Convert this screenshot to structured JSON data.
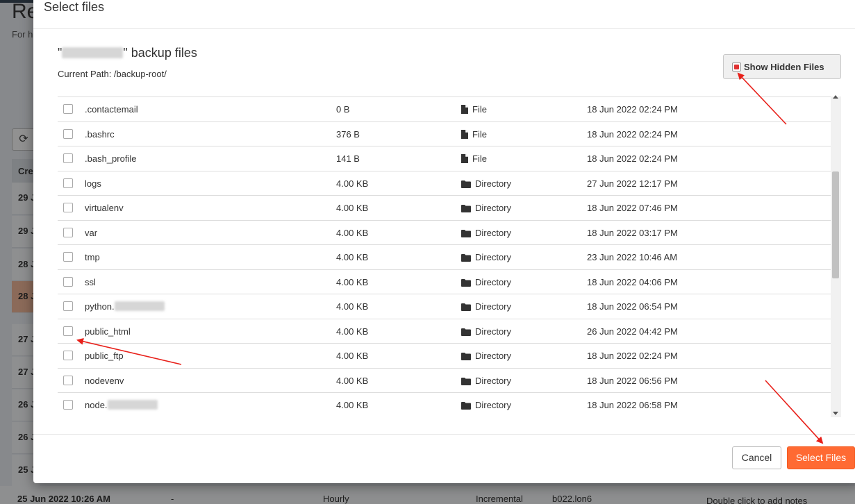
{
  "background": {
    "title": "Re",
    "subtitle": "For h",
    "table_header": "Cre",
    "rows": [
      "29 J",
      "29 J",
      "28 J",
      "28 J",
      "27 J",
      "27 J",
      "26 J",
      "26 J",
      "25 J"
    ],
    "bottom_row": {
      "created": "25 Jun 2022 10:26 AM",
      "dash": "-",
      "frequency": "Hourly",
      "type": "Incremental",
      "server": "b022.lon6",
      "notes": "Double click to add notes"
    }
  },
  "modal": {
    "title": "Select files",
    "files_title_prefix": "\"",
    "files_title_suffix": "\" backup files",
    "current_path_label": "Current Path: /backup-root/",
    "show_hidden_label": "Show Hidden Files",
    "cancel_label": "Cancel",
    "select_label": "Select Files",
    "files": [
      {
        "name": ".contactemail",
        "size": "0 B",
        "type": "File",
        "date": "18 Jun 2022 02:24 PM",
        "icon": "file-icon"
      },
      {
        "name": ".bashrc",
        "size": "376 B",
        "type": "File",
        "date": "18 Jun 2022 02:24 PM",
        "icon": "file-icon"
      },
      {
        "name": ".bash_profile",
        "size": "141 B",
        "type": "File",
        "date": "18 Jun 2022 02:24 PM",
        "icon": "file-icon"
      },
      {
        "name": "logs",
        "size": "4.00 KB",
        "type": "Directory",
        "date": "27 Jun 2022 12:17 PM",
        "icon": "folder-icon"
      },
      {
        "name": "virtualenv",
        "size": "4.00 KB",
        "type": "Directory",
        "date": "18 Jun 2022 07:46 PM",
        "icon": "folder-icon"
      },
      {
        "name": "var",
        "size": "4.00 KB",
        "type": "Directory",
        "date": "18 Jun 2022 03:17 PM",
        "icon": "folder-icon"
      },
      {
        "name": "tmp",
        "size": "4.00 KB",
        "type": "Directory",
        "date": "23 Jun 2022 10:46 AM",
        "icon": "folder-icon"
      },
      {
        "name": "ssl",
        "size": "4.00 KB",
        "type": "Directory",
        "date": "18 Jun 2022 04:06 PM",
        "icon": "folder-icon"
      },
      {
        "name": "python.",
        "size": "4.00 KB",
        "type": "Directory",
        "date": "18 Jun 2022 06:54 PM",
        "icon": "folder-icon"
      },
      {
        "name": "public_html",
        "size": "4.00 KB",
        "type": "Directory",
        "date": "26 Jun 2022 04:42 PM",
        "icon": "folder-icon"
      },
      {
        "name": "public_ftp",
        "size": "4.00 KB",
        "type": "Directory",
        "date": "18 Jun 2022 02:24 PM",
        "icon": "folder-icon"
      },
      {
        "name": "nodevenv",
        "size": "4.00 KB",
        "type": "Directory",
        "date": "18 Jun 2022 06:56 PM",
        "icon": "folder-icon"
      },
      {
        "name": "node.",
        "size": "4.00 KB",
        "type": "Directory",
        "date": "18 Jun 2022 06:58 PM",
        "icon": "folder-icon"
      }
    ]
  },
  "colors": {
    "accent": "#ff6a33",
    "annotation_arrow": "#e8201a",
    "highlight_row": "#f0b79a"
  }
}
